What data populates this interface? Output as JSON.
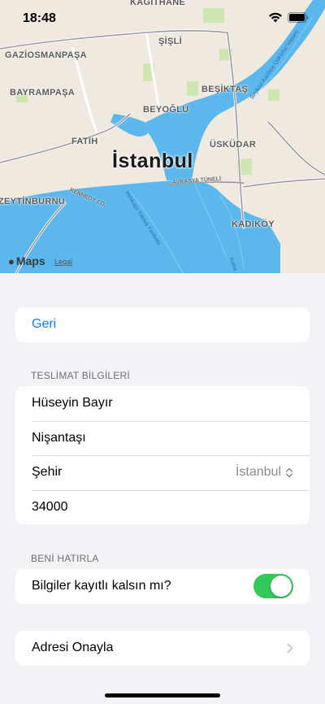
{
  "status": {
    "time": "18:48"
  },
  "map": {
    "city": "İstanbul",
    "districts": {
      "kagithane": "KAĞITHANE",
      "gaziosmanpasa": "GAZİOSMANPAŞA",
      "sisli": "ŞİŞLİ",
      "bayrampasa": "BAYRAMPAŞA",
      "besiktas": "BEŞİKTAŞ",
      "beyoglu": "BEYOĞLU",
      "fatih": "FATİH",
      "uskudar": "ÜSKÜDAR",
      "zeytinburnu": "ZEYTİNBURNU",
      "kadikoy": "KADIKÖY"
    },
    "roads": {
      "avrasya": "AVRASYA TÜNELİ",
      "kennedy": "KENNEDY CD.",
      "ferry": "Yenikapı-Yalova Feribotu",
      "beykoz": "Beykoz-Kanlıca-Üsküdar Vapuru",
      "kaba": "Kaba"
    },
    "attribution": "Maps",
    "legal": "Legal"
  },
  "nav": {
    "back_label": "Geri"
  },
  "delivery": {
    "header": "TESLİMAT BİLGİLERİ",
    "name": "Hüseyin Bayır",
    "address": "Nişantaşı",
    "city_label": "Şehir",
    "city_value": "İstanbul",
    "postal_code": "34000"
  },
  "remember": {
    "header": "BENİ HATIRLA",
    "label": "Bilgiler kayıtlı kalsın mı?",
    "enabled": true
  },
  "confirm": {
    "label": "Adresi Onayla"
  },
  "colors": {
    "accent": "#0a7aff",
    "toggle_on": "#34c759",
    "water": "#5cb8ec"
  }
}
